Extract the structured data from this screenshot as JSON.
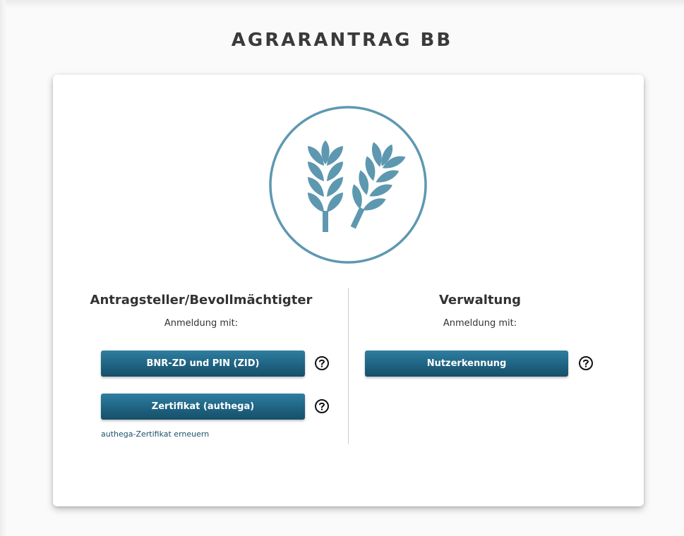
{
  "app": {
    "title": "AGRARANTRAG BB"
  },
  "logo": {
    "icon": "wheat-icon",
    "color": "#5e98b0"
  },
  "left_column": {
    "heading": "Antragsteller/Bevollmächtigter",
    "subheading": "Anmeldung mit:",
    "buttons": [
      {
        "label": "BNR-ZD und PIN (ZID)",
        "help_icon": "help-icon"
      },
      {
        "label": "Zertifikat (authega)",
        "help_icon": "help-icon"
      }
    ],
    "link": "authega-Zertifikat erneuern"
  },
  "right_column": {
    "heading": "Verwaltung",
    "subheading": "Anmeldung mit:",
    "buttons": [
      {
        "label": "Nutzerkennung",
        "help_icon": "help-icon"
      }
    ]
  },
  "colors": {
    "button": "#1f6382",
    "link": "#1c4f6a",
    "title": "#3a3a3a"
  }
}
